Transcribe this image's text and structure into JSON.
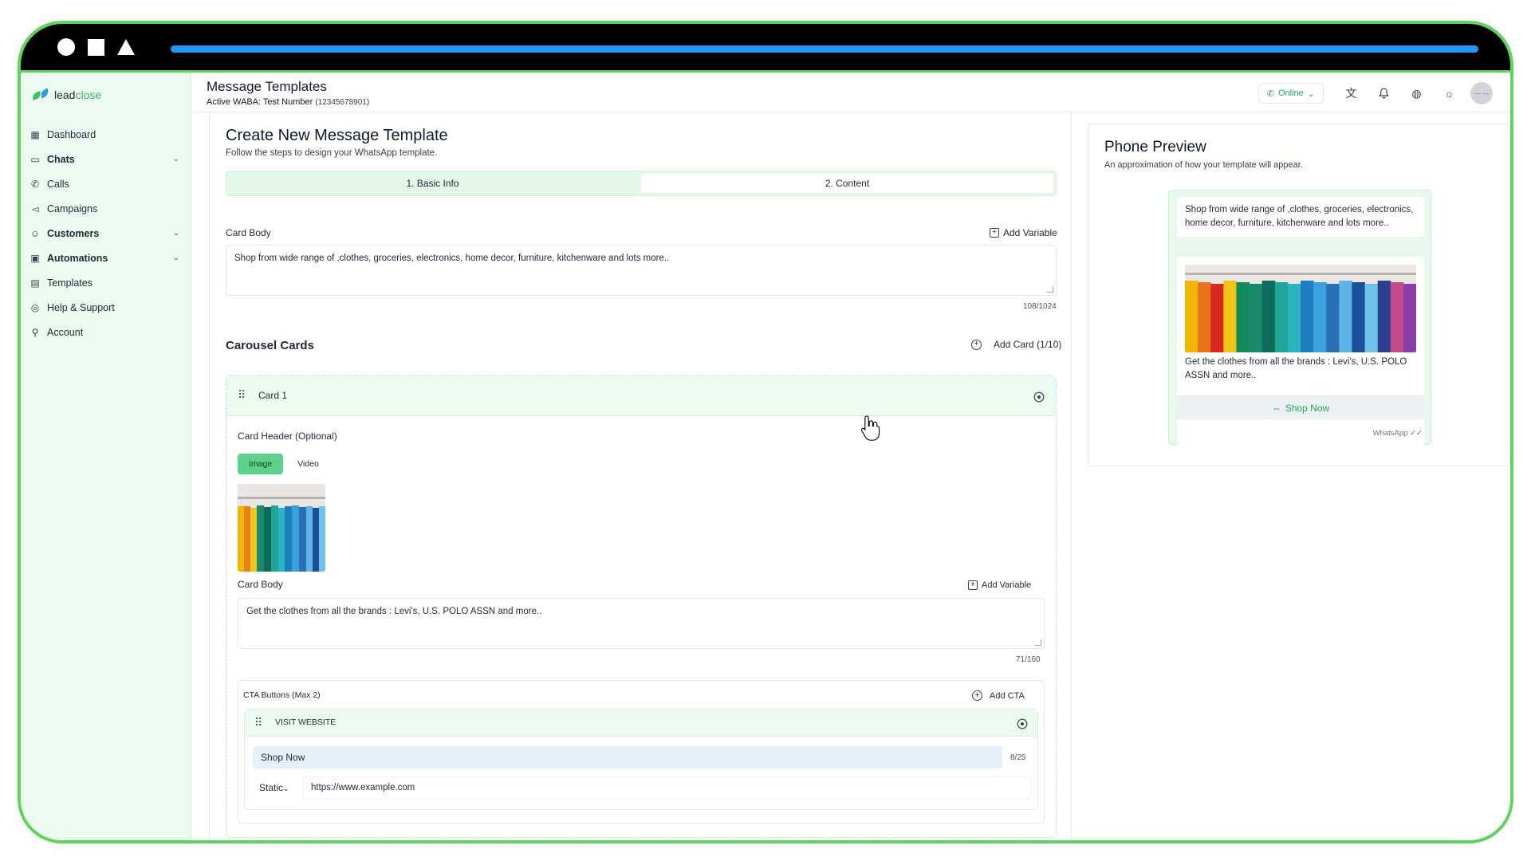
{
  "app": {
    "logo_text_a": "lead",
    "logo_text_b": "close"
  },
  "sidebar": {
    "items": [
      {
        "label": "Dashboard",
        "icon": "dashboard-icon",
        "glyph": "▦",
        "chev": false,
        "bold": false
      },
      {
        "label": "Chats",
        "icon": "chat-icon",
        "glyph": "▭",
        "chev": true,
        "bold": true
      },
      {
        "label": "Calls",
        "icon": "phone-icon",
        "glyph": "✆",
        "chev": false,
        "bold": false
      },
      {
        "label": "Campaigns",
        "icon": "megaphone-icon",
        "glyph": "◅",
        "chev": false,
        "bold": false
      },
      {
        "label": "Customers",
        "icon": "users-icon",
        "glyph": "☺",
        "chev": true,
        "bold": true
      },
      {
        "label": "Automations",
        "icon": "bot-icon",
        "glyph": "▣",
        "chev": true,
        "bold": true
      },
      {
        "label": "Templates",
        "icon": "file-icon",
        "glyph": "▤",
        "chev": false,
        "bold": false
      },
      {
        "label": "Help & Support",
        "icon": "help-icon",
        "glyph": "◎",
        "chev": false,
        "bold": false
      },
      {
        "label": "Account",
        "icon": "account-icon",
        "glyph": "⚲",
        "chev": false,
        "bold": false
      }
    ]
  },
  "header": {
    "title": "Message Templates",
    "sub_prefix": "Active WABA: ",
    "sub_name": "Test Number",
    "sub_number": "(12345678901)",
    "status": "Online",
    "avatar_text": "— —"
  },
  "form": {
    "title": "Create New Message Template",
    "subtitle": "Follow the steps to design your WhatsApp template.",
    "steps": [
      "1. Basic Info",
      "2. Content"
    ],
    "card_body_label": "Card Body",
    "add_variable": "Add Variable",
    "body_text": "Shop from wide range of ,clothes, groceries, electronics, home decor, furniture, kitchenware and lots more..",
    "body_counter": "108/1024",
    "carousel_title": "Carousel Cards",
    "add_card": "Add Card (1/10)",
    "card": {
      "name": "Card 1",
      "header_label": "Card Header (Optional)",
      "media_options": [
        "Image",
        "Video"
      ],
      "body_label": "Card Body",
      "add_variable": "Add Variable",
      "body_text": "Get the clothes from all the brands : Levi's, U.S. POLO ASSN and more..",
      "body_counter": "71/160",
      "cta_label": "CTA Buttons (Max 2)",
      "add_cta": "Add CTA",
      "cta_type": "VISIT WEBSITE",
      "cta_text": "Shop Now",
      "cta_counter": "8/25",
      "url_type": "Static",
      "url": "https://www.example.com"
    }
  },
  "preview": {
    "title": "Phone Preview",
    "subtitle": "An approximation of how your template will appear.",
    "message": "Shop from wide range of ,clothes, groceries, electronics, home decor, furniture, kitchenware and lots more..",
    "card_text": "Get the clothes from all the brands : Levi's, U.S. POLO ASSN and more..",
    "button": "Shop Now",
    "footer": "WhatsApp ✓✓"
  },
  "colors": {
    "accent": "#5fd35a",
    "active_tab": "#5bd189",
    "sidebar_bg": "#ecfbef",
    "url_bar": "#2196f3"
  }
}
